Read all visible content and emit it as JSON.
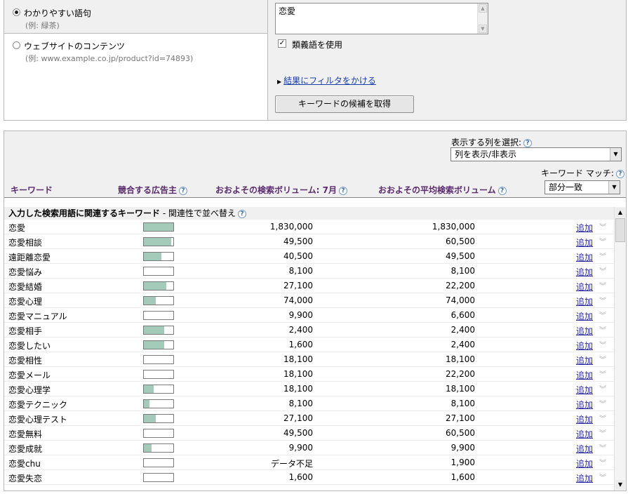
{
  "search": {
    "option_words": {
      "label": "わかりやすい語句",
      "hint": "(例: 緑茶)",
      "selected": true
    },
    "option_website": {
      "label": "ウェブサイトのコンテンツ",
      "hint": "(例: www.example.co.jp/product?id=74893)",
      "selected": false
    },
    "query_text": "恋愛",
    "synonyms_label": "類義語を使用",
    "synonyms_checked": true,
    "filter_link": "結果にフィルタをかける",
    "get_button": "キーワードの候補を取得"
  },
  "results_header": {
    "column_select_label": "表示する列を選択:",
    "column_select_value": "列を表示/非表示",
    "keyword_match_label": "キーワード マッチ:",
    "keyword_match_value": "部分一致",
    "columns": {
      "keyword": "キーワード",
      "competition": "競合する広告主",
      "volume_month": "おおよその検索ボリューム: 7月",
      "volume_avg": "おおよその平均検索ボリューム"
    }
  },
  "section": {
    "title": "入力した検索用語に関連するキーワード",
    "sort": " - 関連性で並べ替え"
  },
  "add_label": "追加",
  "rows": [
    {
      "keyword": "恋愛",
      "competition": 1.0,
      "volume_month": "1,830,000",
      "volume_avg": "1,830,000"
    },
    {
      "keyword": "恋愛相談",
      "competition": 0.93,
      "volume_month": "49,500",
      "volume_avg": "60,500"
    },
    {
      "keyword": "遠距離恋愛",
      "competition": 0.6,
      "volume_month": "40,500",
      "volume_avg": "49,500"
    },
    {
      "keyword": "恋愛悩み",
      "competition": 0.0,
      "volume_month": "8,100",
      "volume_avg": "8,100"
    },
    {
      "keyword": "恋愛結婚",
      "competition": 0.75,
      "volume_month": "27,100",
      "volume_avg": "22,200"
    },
    {
      "keyword": "恋愛心理",
      "competition": 0.4,
      "volume_month": "74,000",
      "volume_avg": "74,000"
    },
    {
      "keyword": "恋愛マニュアル",
      "competition": 0.0,
      "volume_month": "9,900",
      "volume_avg": "6,600"
    },
    {
      "keyword": "恋愛相手",
      "competition": 0.68,
      "volume_month": "2,400",
      "volume_avg": "2,400"
    },
    {
      "keyword": "恋愛したい",
      "competition": 0.68,
      "volume_month": "1,600",
      "volume_avg": "2,400"
    },
    {
      "keyword": "恋愛相性",
      "competition": 0.0,
      "volume_month": "18,100",
      "volume_avg": "18,100"
    },
    {
      "keyword": "恋愛メール",
      "competition": 0.0,
      "volume_month": "18,100",
      "volume_avg": "22,200"
    },
    {
      "keyword": "恋愛心理学",
      "competition": 0.33,
      "volume_month": "18,100",
      "volume_avg": "18,100"
    },
    {
      "keyword": "恋愛テクニック",
      "competition": 0.2,
      "volume_month": "8,100",
      "volume_avg": "8,100"
    },
    {
      "keyword": "恋愛心理テスト",
      "competition": 0.4,
      "volume_month": "27,100",
      "volume_avg": "27,100"
    },
    {
      "keyword": "恋愛無料",
      "competition": 0.0,
      "volume_month": "49,500",
      "volume_avg": "60,500"
    },
    {
      "keyword": "恋愛成就",
      "competition": 0.27,
      "volume_month": "9,900",
      "volume_avg": "9,900"
    },
    {
      "keyword": "恋愛chu",
      "competition": 0.0,
      "volume_month": "データ不足",
      "volume_avg": "1,900"
    },
    {
      "keyword": "恋愛失恋",
      "competition": 0.0,
      "volume_month": "1,600",
      "volume_avg": "1,600"
    }
  ],
  "colors": {
    "bar_fill": "#a4cbb9",
    "header_text": "#5a2b6e",
    "link": "#2b2b9e"
  }
}
